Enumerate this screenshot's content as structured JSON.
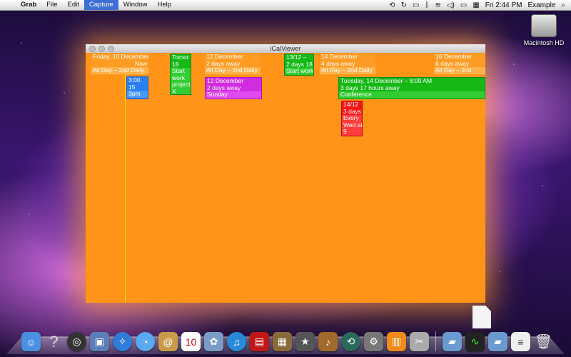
{
  "menubar": {
    "items": [
      {
        "label": "Grab",
        "app": true
      },
      {
        "label": "File"
      },
      {
        "label": "Edit"
      },
      {
        "label": "Capture",
        "active": true
      },
      {
        "label": "Window"
      },
      {
        "label": "Help"
      }
    ],
    "clock": "Fri 2:44 PM",
    "user": "Example"
  },
  "desktop": {
    "hd_label": "Macintosh HD"
  },
  "window": {
    "title": "iCalViewer"
  },
  "events": {
    "e1": {
      "l1": "Friday, 10 December",
      "l2": "Now",
      "l3": "All Day – 2nd Daily"
    },
    "e2": {
      "l1": "3:00",
      "l2": "15",
      "l3": "3pm"
    },
    "e3": {
      "l1": "Tomor",
      "l2": "18",
      "l3": "Start",
      "l4": "work",
      "l5": "project",
      "l6": "X"
    },
    "e4": {
      "l1": "12 December",
      "l2": "2 days away",
      "l3": "All Day – 2nd Daily"
    },
    "e5": {
      "l1": "12 December",
      "l2": "2 days away",
      "l3": "Sunday"
    },
    "e6": {
      "l1": "13/12 –",
      "l2": "2 days 18",
      "l3": "Start work"
    },
    "e7": {
      "l1": "14 December",
      "l2": "4 days away",
      "l3": "All Day – 2nd Daily"
    },
    "e8": {
      "l1": "Tuesday, 14 December – 8:00 AM",
      "l2": "3 days 17 hours away",
      "l3": "Conference"
    },
    "e9": {
      "l1": "14/12",
      "l2": "3 days",
      "l3": "Every",
      "l4": "Wed at",
      "l5": "9"
    },
    "e10": {
      "l1": "16 December",
      "l2": "6 days away",
      "l3": "All Day – 2nd"
    }
  },
  "colors": {
    "window_bg": "#ff9418",
    "now_line": "#ffe400"
  },
  "dock_icons": [
    "finder-icon",
    "help-icon",
    "dashboard-icon",
    "preview-icon",
    "safari-icon",
    "ichat-icon",
    "address-book-icon",
    "ical-icon",
    "iphoto-icon",
    "itunes-icon",
    "photo-booth-icon",
    "iphoto-alt-icon",
    "imovie-icon",
    "garageband-icon",
    "time-machine-icon",
    "system-preferences-icon",
    "icalviewer-icon",
    "grab-icon",
    "applications-folder-icon",
    "activity-monitor-icon",
    "documents-folder-icon",
    "document-icon",
    "trash-icon"
  ]
}
